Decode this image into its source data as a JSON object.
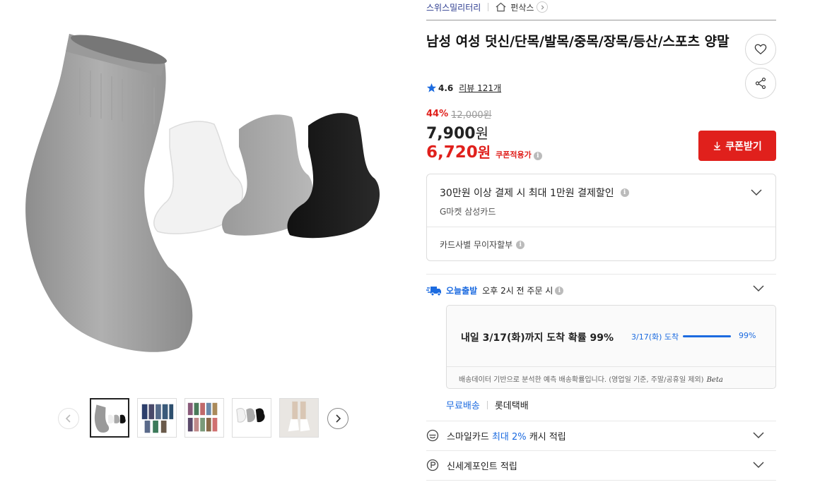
{
  "breadcrumb": {
    "brand": "스위스밀리터리",
    "store": "펀삭스"
  },
  "product": {
    "title": "남성 여성 덧신/단목/발목/중목/장목/등산/스포츠 양말",
    "rating": "4.6",
    "review_label": "리뷰 121개",
    "discount_rate": "44%",
    "original_price": "12,000원",
    "sale_price": "7,900",
    "sale_unit": "원",
    "coupon_price": "6,720",
    "coupon_unit": "원",
    "coupon_note": "쿠폰적용가",
    "coupon_button": "쿠폰받기"
  },
  "card_promo": {
    "title": "30만원 이상 결제 시 최대 1만원 결제할인",
    "subtitle": "G마켓 삼성카드",
    "installment": "카드사별 무이자할부"
  },
  "delivery": {
    "today_label": "오늘출발",
    "cutoff": "오후 2시 전 주문 시",
    "prediction": "내일 3/17(화)까지 도착 확률 99%",
    "predict_date": "3/17(화) 도착",
    "predict_percent": "99%",
    "predict_fill": 0.99,
    "note": "배송데이터 기반으로 분석한 예측 배송확률입니다. (영업일 기준, 주말/공휴일 제외)",
    "beta": "Beta",
    "free_shipping": "무료배송",
    "carrier": "롯데택배"
  },
  "benefits": {
    "smile_prefix": "스마일카드",
    "smile_highlight": "최대 2%",
    "smile_suffix": "캐시 적립",
    "shinsegae": "신세계포인트 적립"
  },
  "icons": {
    "home": "home-icon",
    "heart": "heart-icon",
    "share": "share-icon",
    "star": "star-icon",
    "download": "download-icon",
    "truck": "truck-icon",
    "smile": "smile-icon",
    "point": "point-icon"
  },
  "colors": {
    "accent_red": "#e0201c",
    "accent_blue": "#1c6be0",
    "brand_navy": "#2b3b8f",
    "star_blue": "#1c6be0"
  }
}
